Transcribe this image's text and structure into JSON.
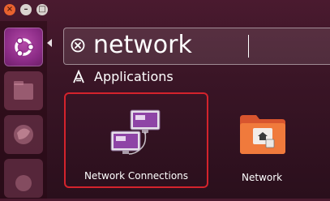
{
  "window": {
    "controls": {
      "close": "×",
      "minimize": "–",
      "maximize": "□"
    }
  },
  "launcher": {
    "items": [
      {
        "icon": "ubuntu-logo-icon"
      },
      {
        "icon": "files-icon"
      },
      {
        "icon": "browser-icon"
      },
      {
        "icon": "app-icon"
      }
    ]
  },
  "search": {
    "query": "network",
    "clear_icon": "clear-icon"
  },
  "categories": [
    {
      "title": "Applications",
      "icon": "applications-icon",
      "results": [
        {
          "label": "Network Connections",
          "icon": "network-connections-icon",
          "selected": true
        },
        {
          "label": "Network",
          "icon": "network-folder-icon",
          "selected": false
        }
      ]
    }
  ],
  "colors": {
    "selection_border": "#d4232c",
    "background": "#3a1526",
    "accent": "#8b2b86"
  }
}
